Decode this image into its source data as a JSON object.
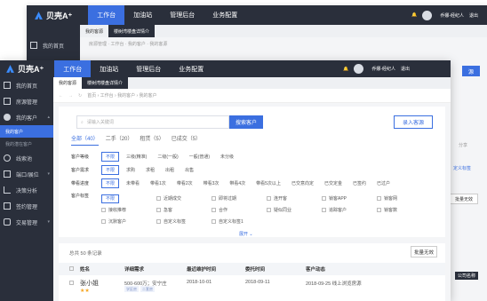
{
  "brand": "贝壳A⁺",
  "nav": [
    "工作台",
    "加油站",
    "管理后台",
    "业务配置"
  ],
  "user": {
    "name": "乔娜-经纪人",
    "logout": "退出"
  },
  "tabs": [
    "我的客源",
    "楼树湾楼盘详情介"
  ],
  "back": {
    "crumb": "房源管理 · 工作台 · 我的客户 · 我的客源",
    "side_item": "我的首页",
    "right1": "源",
    "right2": "批量无效",
    "right3": "公司名称",
    "right4": "分享",
    "right5": "定义标签"
  },
  "sidebar": {
    "items": [
      "我的首页",
      "房源管理",
      "我的客户",
      "线索池",
      "端口/展位",
      "决策分析",
      "签约管理",
      "交易管理"
    ],
    "subs": [
      "我的客户",
      "我的潜在客户"
    ]
  },
  "crumb": "首页 › 工作台 › 我的客户 › 我的客户",
  "search": {
    "placeholder": "请输入关键词",
    "btn": "搜索客户",
    "new_btn": "录入客源"
  },
  "filter_tabs": [
    "全部（40）",
    "二手（20）",
    "租赁（5）",
    "已成交（5）"
  ],
  "rows": {
    "level": {
      "label": "客户等级",
      "opts": [
        "不限",
        "三级(精准)",
        "二级(一般)",
        "一般(普通)",
        "未分级"
      ]
    },
    "demand": {
      "label": "客户需求",
      "opts": [
        "不限",
        "求购",
        "求租",
        "出租",
        "出售"
      ]
    },
    "progress": {
      "label": "带看进度",
      "opts": [
        "不限",
        "未带看",
        "带看1次",
        "带看2次",
        "带看3次",
        "带看4次",
        "带看5次以上",
        "已交意向定",
        "已交定金",
        "已签约",
        "已过户"
      ]
    },
    "tags": {
      "label": "客户标签",
      "opts": [
        "不限",
        "近期成交",
        "即将过期",
        "连开客",
        "锁客APP",
        "锁客网",
        "接收推荐",
        "急客",
        "合作",
        "疑似同业",
        "追踪客户",
        "锁客数",
        "沉默客户",
        "自定义标签",
        "自定义标签1"
      ]
    }
  },
  "expand": "展开 ⌄",
  "list": {
    "total": "总共 50 条记录",
    "batch": "批量无效",
    "headers": [
      "姓名",
      "详细需求",
      "最近维护时间",
      "委托时间",
      "客户动态"
    ],
    "row": {
      "name": "张小姐",
      "demand": "500-600万；安宁庄",
      "maint": "2018-10-01",
      "entrust": "2018-09-11",
      "dynamic": "2018-09-25 线上浏览房源",
      "tags": [
        "学区房",
        "二套房"
      ]
    }
  }
}
